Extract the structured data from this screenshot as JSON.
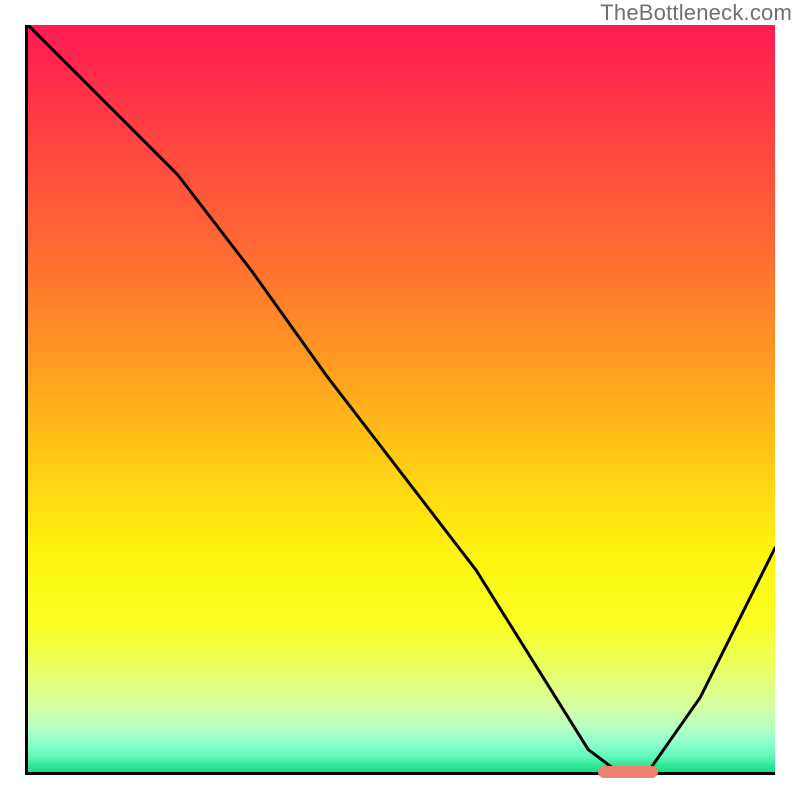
{
  "watermark": "TheBottleneck.com",
  "chart_data": {
    "type": "line",
    "title": "",
    "xlabel": "",
    "ylabel": "",
    "xlim": [
      0,
      100
    ],
    "ylim": [
      0,
      100
    ],
    "grid": false,
    "series": [
      {
        "name": "bottleneck-curve",
        "x": [
          0,
          12,
          20,
          30,
          40,
          50,
          60,
          70,
          75,
          79,
          83,
          90,
          100
        ],
        "y": [
          100,
          88,
          80,
          67,
          53,
          40,
          27,
          11,
          3,
          0,
          0,
          10,
          30
        ]
      }
    ],
    "marker": {
      "x_start": 76,
      "x_end": 84,
      "y": 0
    },
    "colors": {
      "gradient_top": "#ff1a53",
      "gradient_mid": "#fff30d",
      "gradient_bottom": "#1bdc88",
      "curve": "#000000",
      "marker": "#ec826f"
    }
  }
}
